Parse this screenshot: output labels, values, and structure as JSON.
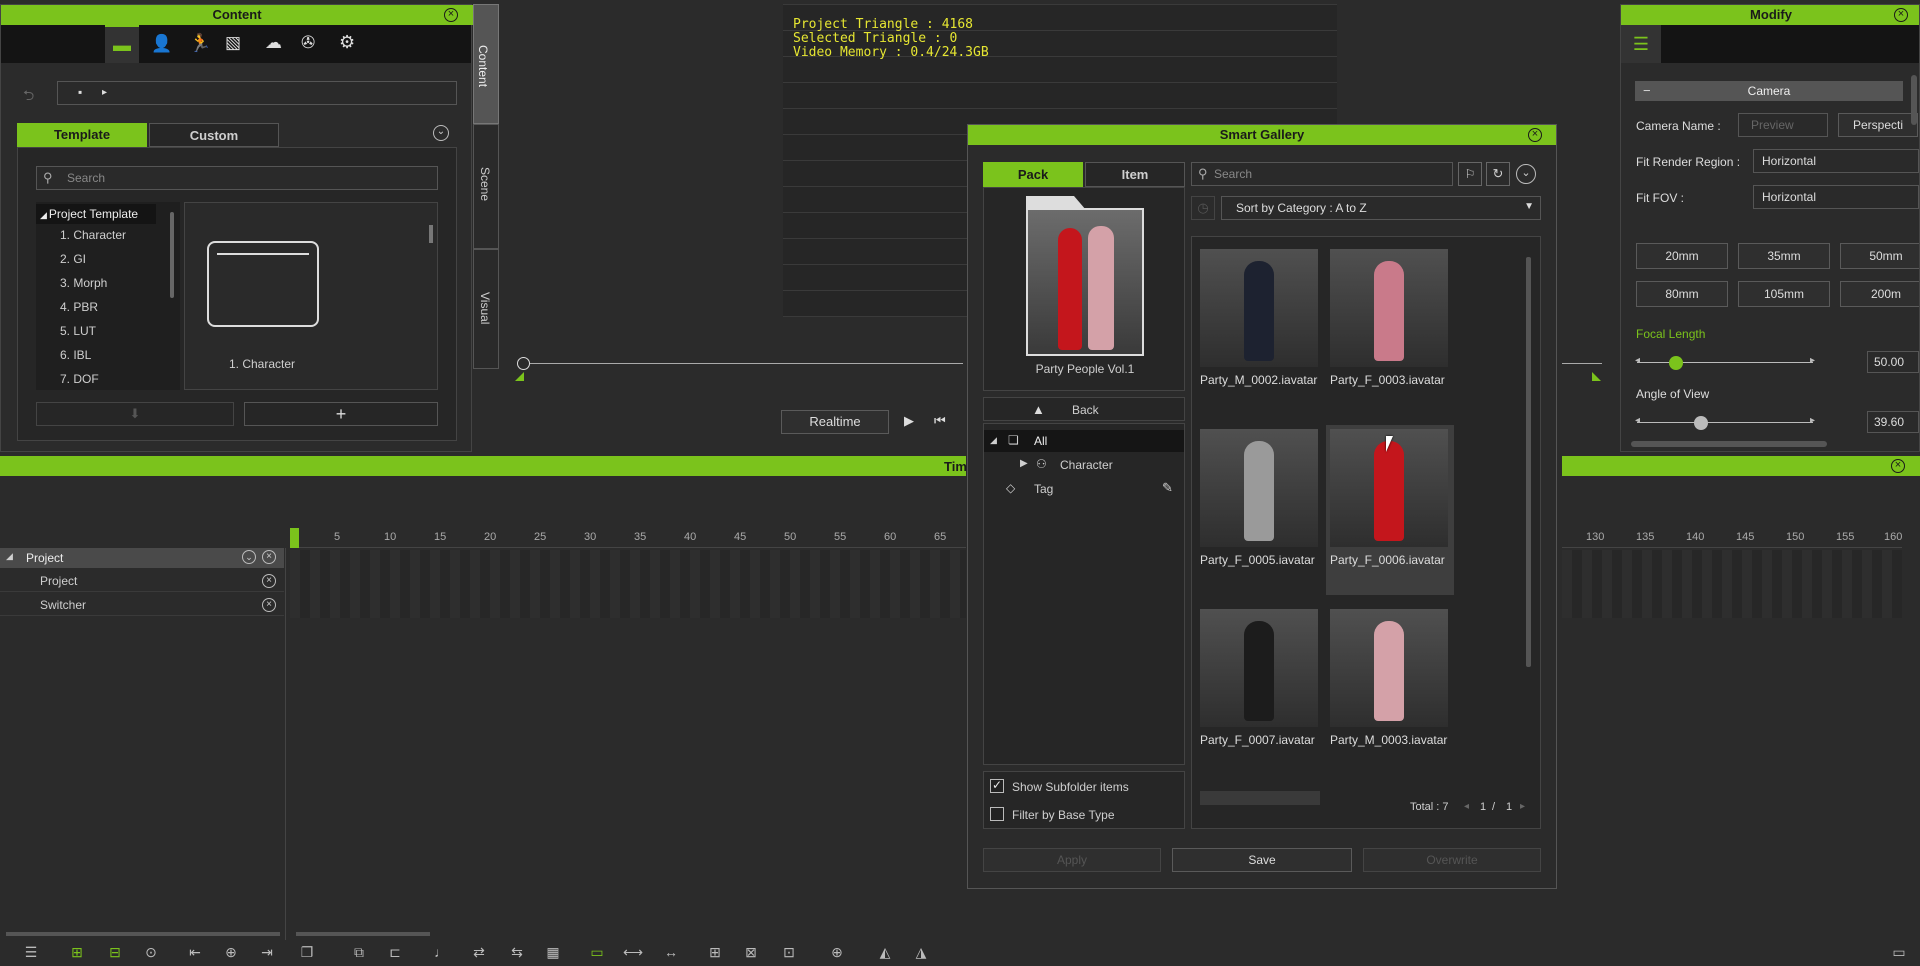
{
  "content_panel": {
    "title": "Content",
    "tabs": [
      "Template",
      "Custom"
    ],
    "search_placeholder": "Search",
    "tree": [
      {
        "label": "Project Template"
      },
      {
        "label": "1. Character"
      },
      {
        "label": "2. GI"
      },
      {
        "label": "3. Morph"
      },
      {
        "label": "4. PBR"
      },
      {
        "label": "5. LUT"
      },
      {
        "label": "6. IBL"
      },
      {
        "label": "7. DOF"
      }
    ],
    "folder_label": "1. Character",
    "side_tabs": [
      "Content",
      "Scene",
      "Visual"
    ]
  },
  "viewport": {
    "stats": [
      "Project Triangle : 4168",
      "Selected Triangle : 0",
      "Video Memory : 0.4/24.3GB"
    ],
    "realtime_label": "Realtime"
  },
  "smart_gallery": {
    "title": "Smart Gallery",
    "tabs": [
      "Pack",
      "Item"
    ],
    "pack_name": "Party People Vol.1",
    "back_label": "Back",
    "tree": {
      "all": "All",
      "character": "Character",
      "tag": "Tag"
    },
    "search_placeholder": "Search",
    "sort_label": "Sort by Category : A to Z",
    "items": [
      {
        "name": "Party_M_0002.iavatar",
        "color": "#1d2230"
      },
      {
        "name": "Party_F_0003.iavatar",
        "color": "#c97a8a"
      },
      {
        "name": "Party_F_0005.iavatar",
        "color": "#9a9a9a"
      },
      {
        "name": "Party_F_0006.iavatar",
        "color": "#c4161c"
      },
      {
        "name": "Party_F_0007.iavatar",
        "color": "#1c1c1c"
      },
      {
        "name": "Party_M_0003.iavatar",
        "color": "#d4a1a8"
      }
    ],
    "show_subfolder_label": "Show Subfolder items",
    "show_subfolder_checked": true,
    "filter_base_label": "Filter by Base Type",
    "filter_base_checked": false,
    "total_label": "Total : 7",
    "page_current": "1",
    "page_sep": "/",
    "page_total": "1",
    "buttons": {
      "apply": "Apply",
      "save": "Save",
      "overwrite": "Overwrite"
    }
  },
  "modify_panel": {
    "title": "Modify",
    "section": "Camera",
    "camera_name_label": "Camera Name :",
    "camera_name_placeholder": "Preview",
    "camera_type": "Perspecti",
    "fit_render_label": "Fit Render Region :",
    "fit_render_value": "Horizontal",
    "fit_fov_label": "Fit FOV :",
    "fit_fov_value": "Horizontal",
    "lens_buttons": [
      "20mm",
      "35mm",
      "50mm",
      "80mm",
      "105mm",
      "200m"
    ],
    "focal_label": "Focal Length",
    "focal_value": "50.00",
    "focal_fraction": 0.2,
    "aov_label": "Angle of View",
    "aov_value": "39.60",
    "aov_fraction": 0.35
  },
  "timeline": {
    "title_fragment": "Tim",
    "rows": [
      "Project",
      "Project",
      "Switcher"
    ],
    "ticks_left": [
      "5",
      "10",
      "15",
      "20",
      "25",
      "30",
      "35",
      "40",
      "45",
      "50",
      "55",
      "60",
      "65"
    ],
    "ticks_right": [
      "130",
      "135",
      "140",
      "145",
      "150",
      "155",
      "160"
    ]
  },
  "colors": {
    "accent": "#7bc31c"
  }
}
